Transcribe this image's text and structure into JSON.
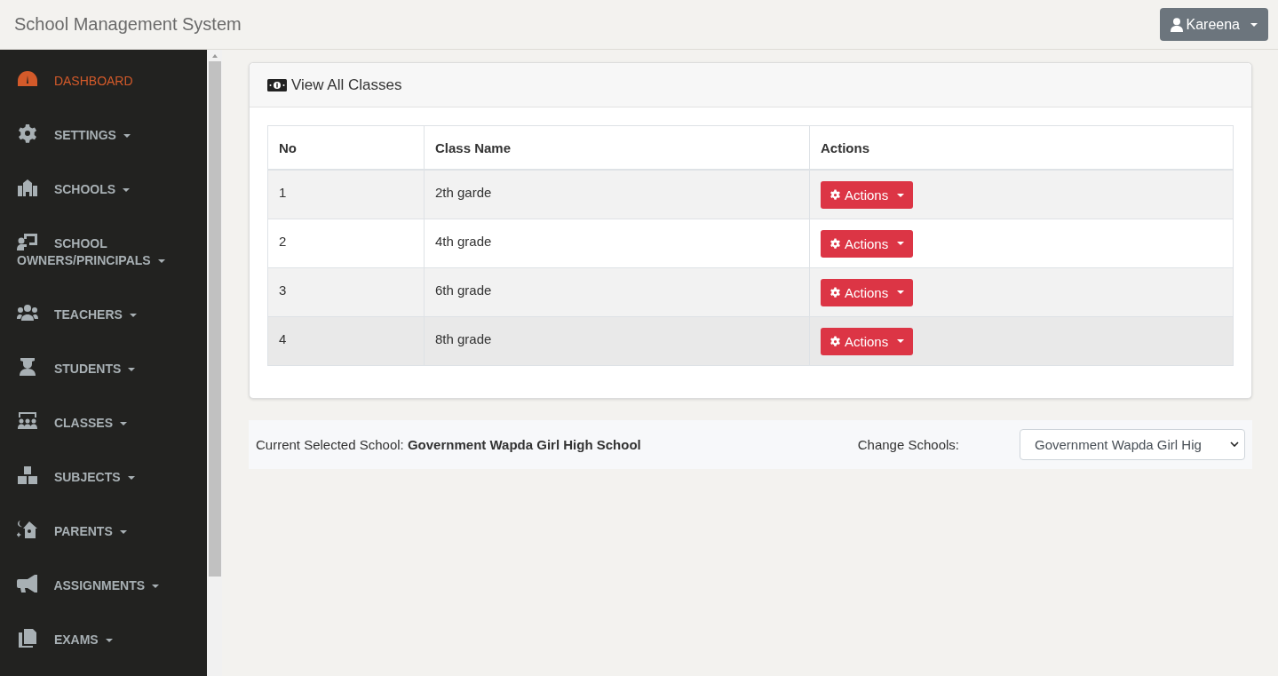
{
  "navbar": {
    "brand": "School Management System",
    "user_menu": {
      "label": "Kareena"
    }
  },
  "sidebar": {
    "items": [
      {
        "label": "DASHBOARD",
        "selected": true,
        "dropdown": false
      },
      {
        "label": "SETTINGS",
        "selected": false,
        "dropdown": true
      },
      {
        "label": "SCHOOLS",
        "selected": false,
        "dropdown": true
      },
      {
        "label": "SCHOOL OWNERS/PRINCIPALS",
        "selected": false,
        "dropdown": true
      },
      {
        "label": "TEACHERS",
        "selected": false,
        "dropdown": true
      },
      {
        "label": "STUDENTS",
        "selected": false,
        "dropdown": true
      },
      {
        "label": "CLASSES",
        "selected": false,
        "dropdown": true
      },
      {
        "label": "SUBJECTS",
        "selected": false,
        "dropdown": true
      },
      {
        "label": "PARENTS",
        "selected": false,
        "dropdown": true
      },
      {
        "label": "ASSIGNMENTS",
        "selected": false,
        "dropdown": true
      },
      {
        "label": "EXAMS",
        "selected": false,
        "dropdown": true
      }
    ]
  },
  "card": {
    "title": "View All Classes",
    "table": {
      "columns": [
        "No",
        "Class Name",
        "Actions"
      ],
      "rows": [
        {
          "no": "1",
          "class_name": "2th garde",
          "action": "Actions"
        },
        {
          "no": "2",
          "class_name": "4th grade",
          "action": "Actions"
        },
        {
          "no": "3",
          "class_name": "6th grade",
          "action": "Actions"
        },
        {
          "no": "4",
          "class_name": "8th grade",
          "action": "Actions"
        }
      ]
    }
  },
  "school_bar": {
    "current_label": "Current Selected School:",
    "current_value": "Government Wapda Girl High School",
    "change_label": "Change Schools:",
    "select_value": "Government Wapda Girl Hig"
  }
}
